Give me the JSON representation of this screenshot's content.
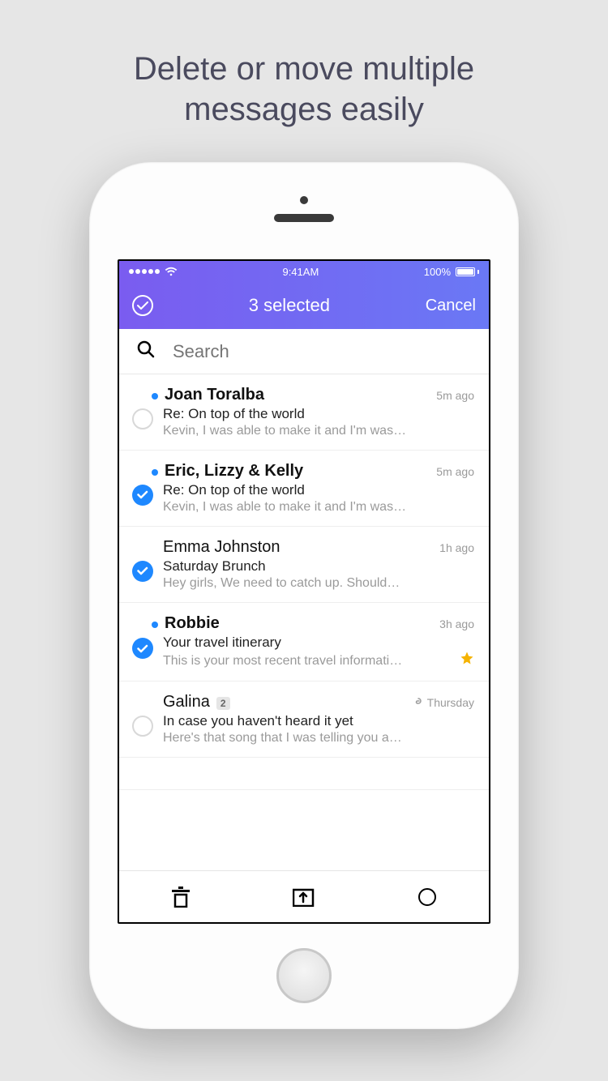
{
  "promo": {
    "tagline_l1": "Delete or move multiple",
    "tagline_l2": "messages easily"
  },
  "status": {
    "time": "9:41AM",
    "battery": "100%"
  },
  "nav": {
    "title": "3 selected",
    "cancel": "Cancel"
  },
  "search": {
    "placeholder": "Search"
  },
  "messages": [
    {
      "selected": false,
      "unread": true,
      "sender": "Joan Toralba",
      "sender_bold": true,
      "time": "5m ago",
      "subject": "Re: On top of the world",
      "preview": "Kevin, I was able to make it and I'm was…",
      "starred": false,
      "attachment": false,
      "count": null
    },
    {
      "selected": true,
      "unread": true,
      "sender": "Eric, Lizzy & Kelly",
      "sender_bold": true,
      "time": "5m ago",
      "subject": "Re: On top of the world",
      "preview": "Kevin, I was able to make it and I'm was…",
      "starred": false,
      "attachment": false,
      "count": null
    },
    {
      "selected": true,
      "unread": false,
      "sender": "Emma Johnston",
      "sender_bold": false,
      "time": "1h ago",
      "subject": "Saturday Brunch",
      "preview": "Hey girls, We need to catch up. Should…",
      "starred": false,
      "attachment": false,
      "count": null
    },
    {
      "selected": true,
      "unread": true,
      "sender": "Robbie",
      "sender_bold": true,
      "time": "3h ago",
      "subject": "Your travel itinerary",
      "preview": "This is your most recent travel informati…",
      "starred": true,
      "attachment": false,
      "count": null
    },
    {
      "selected": false,
      "unread": false,
      "sender": "Galina",
      "sender_bold": false,
      "time": "Thursday",
      "subject": "In case you haven't heard it yet",
      "preview": "Here's that song that I was telling you a…",
      "starred": false,
      "attachment": true,
      "count": "2"
    }
  ]
}
